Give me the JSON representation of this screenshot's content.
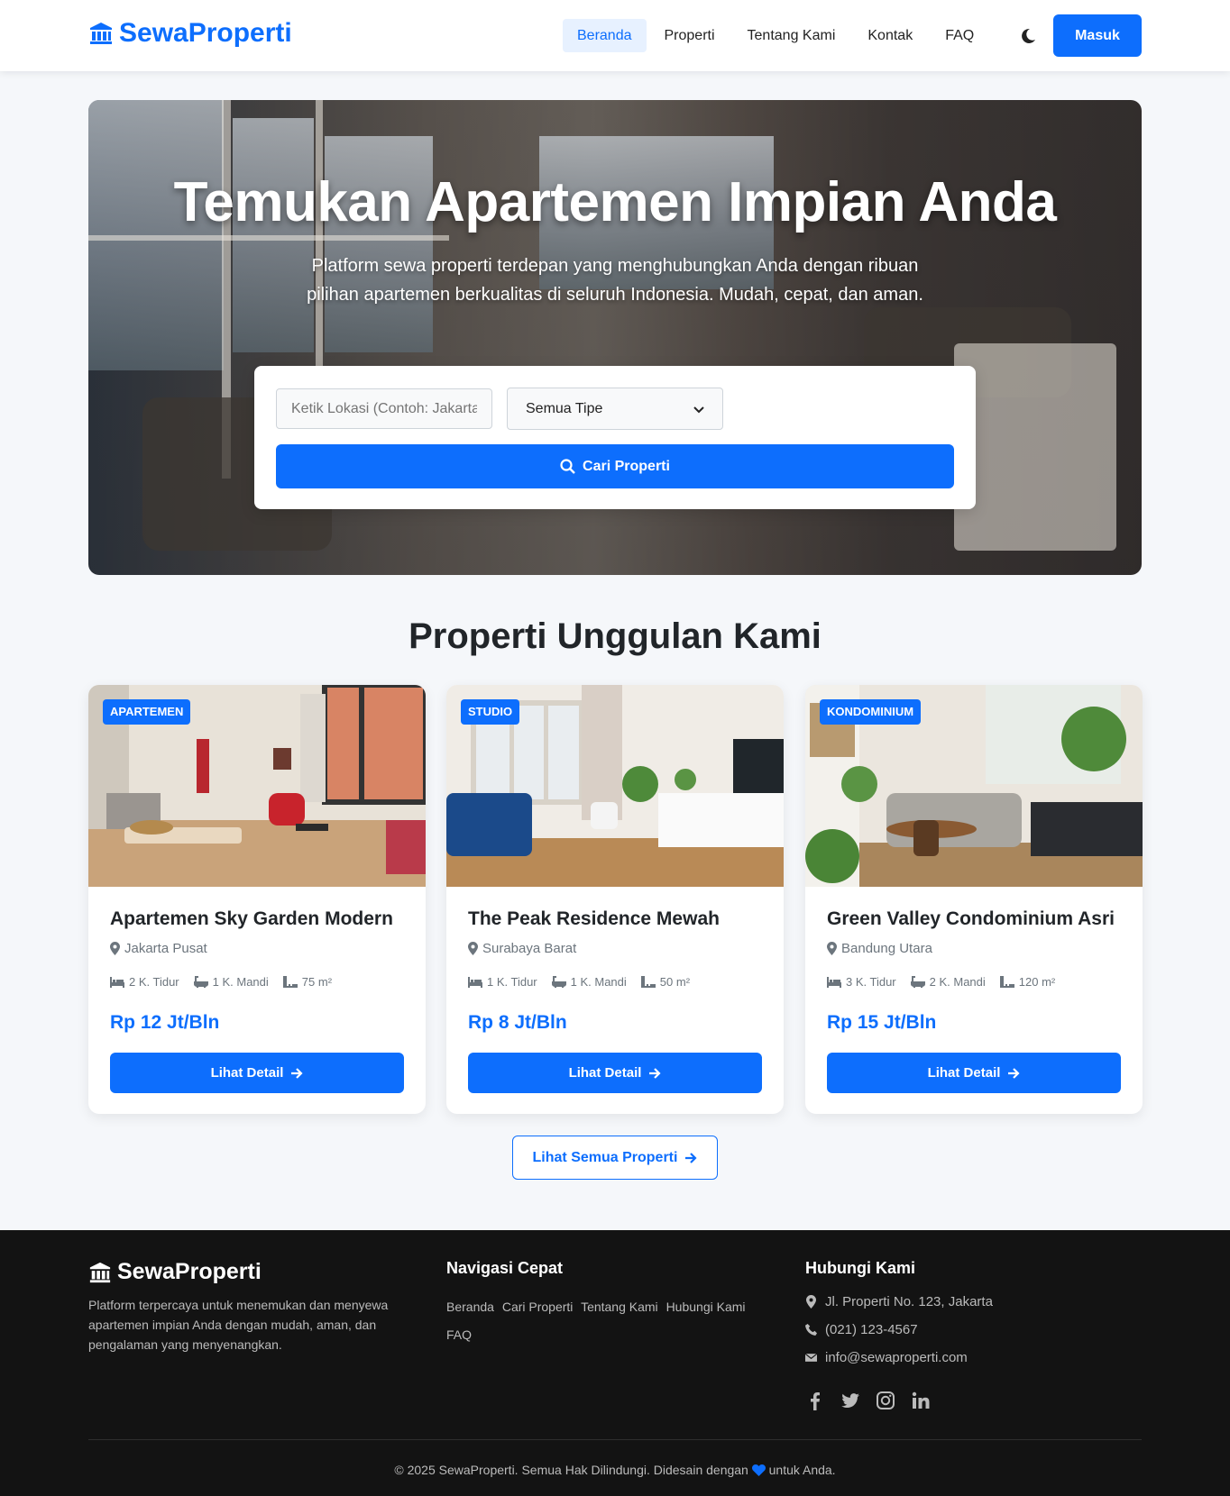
{
  "brand": {
    "name": "SewaProperti",
    "logo_icon": "landmark-icon",
    "color": "#0d6efd"
  },
  "nav": {
    "links": [
      {
        "label": "Beranda",
        "active": true
      },
      {
        "label": "Properti",
        "active": false
      },
      {
        "label": "Tentang Kami",
        "active": false
      },
      {
        "label": "Kontak",
        "active": false
      },
      {
        "label": "FAQ",
        "active": false
      }
    ],
    "theme_icon": "moon-icon",
    "login_label": "Masuk"
  },
  "hero": {
    "title": "Temukan Apartemen Impian Anda",
    "subtitle": "Platform sewa properti terdepan yang menghubungkan Anda dengan ribuan pilihan apartemen berkualitas di seluruh Indonesia. Mudah, cepat, dan aman.",
    "search": {
      "location_placeholder": "Ketik Lokasi (Contoh: Jakarta)",
      "location_value": "",
      "type_selected": "Semua Tipe",
      "button_label": "Cari Properti"
    }
  },
  "featured": {
    "title": "Properti Unggulan Kami",
    "cards": [
      {
        "badge": "APARTEMEN",
        "title": "Apartemen Sky Garden Modern",
        "location": "Jakarta Pusat",
        "bedrooms": "2 K. Tidur",
        "bathrooms": "1 K. Mandi",
        "area": "75 m²",
        "price": "Rp 12 Jt/Bln",
        "button": "Lihat Detail"
      },
      {
        "badge": "STUDIO",
        "title": "The Peak Residence Mewah",
        "location": "Surabaya Barat",
        "bedrooms": "1 K. Tidur",
        "bathrooms": "1 K. Mandi",
        "area": "50 m²",
        "price": "Rp 8 Jt/Bln",
        "button": "Lihat Detail"
      },
      {
        "badge": "KONDOMINIUM",
        "title": "Green Valley Condominium Asri",
        "location": "Bandung Utara",
        "bedrooms": "3 K. Tidur",
        "bathrooms": "2 K. Mandi",
        "area": "120 m²",
        "price": "Rp 15 Jt/Bln",
        "button": "Lihat Detail"
      }
    ],
    "see_all": "Lihat Semua Properti"
  },
  "footer": {
    "brand": "SewaProperti",
    "description": "Platform terpercaya untuk menemukan dan menyewa apartemen impian Anda dengan mudah, aman, dan pengalaman yang menyenangkan.",
    "nav_title": "Navigasi Cepat",
    "nav_links": [
      "Beranda",
      "Cari Properti",
      "Tentang Kami",
      "Hubungi Kami",
      "FAQ"
    ],
    "contact_title": "Hubungi Kami",
    "address": "Jl. Properti No. 123, Jakarta",
    "phone": "(021) 123-4567",
    "email": "info@sewaproperti.com",
    "socials": [
      "facebook-icon",
      "twitter-icon",
      "instagram-icon",
      "linkedin-icon"
    ],
    "copyright_before": "© 2025 SewaProperti. Semua Hak Dilindungi. Didesain dengan",
    "copyright_after": "untuk Anda."
  }
}
